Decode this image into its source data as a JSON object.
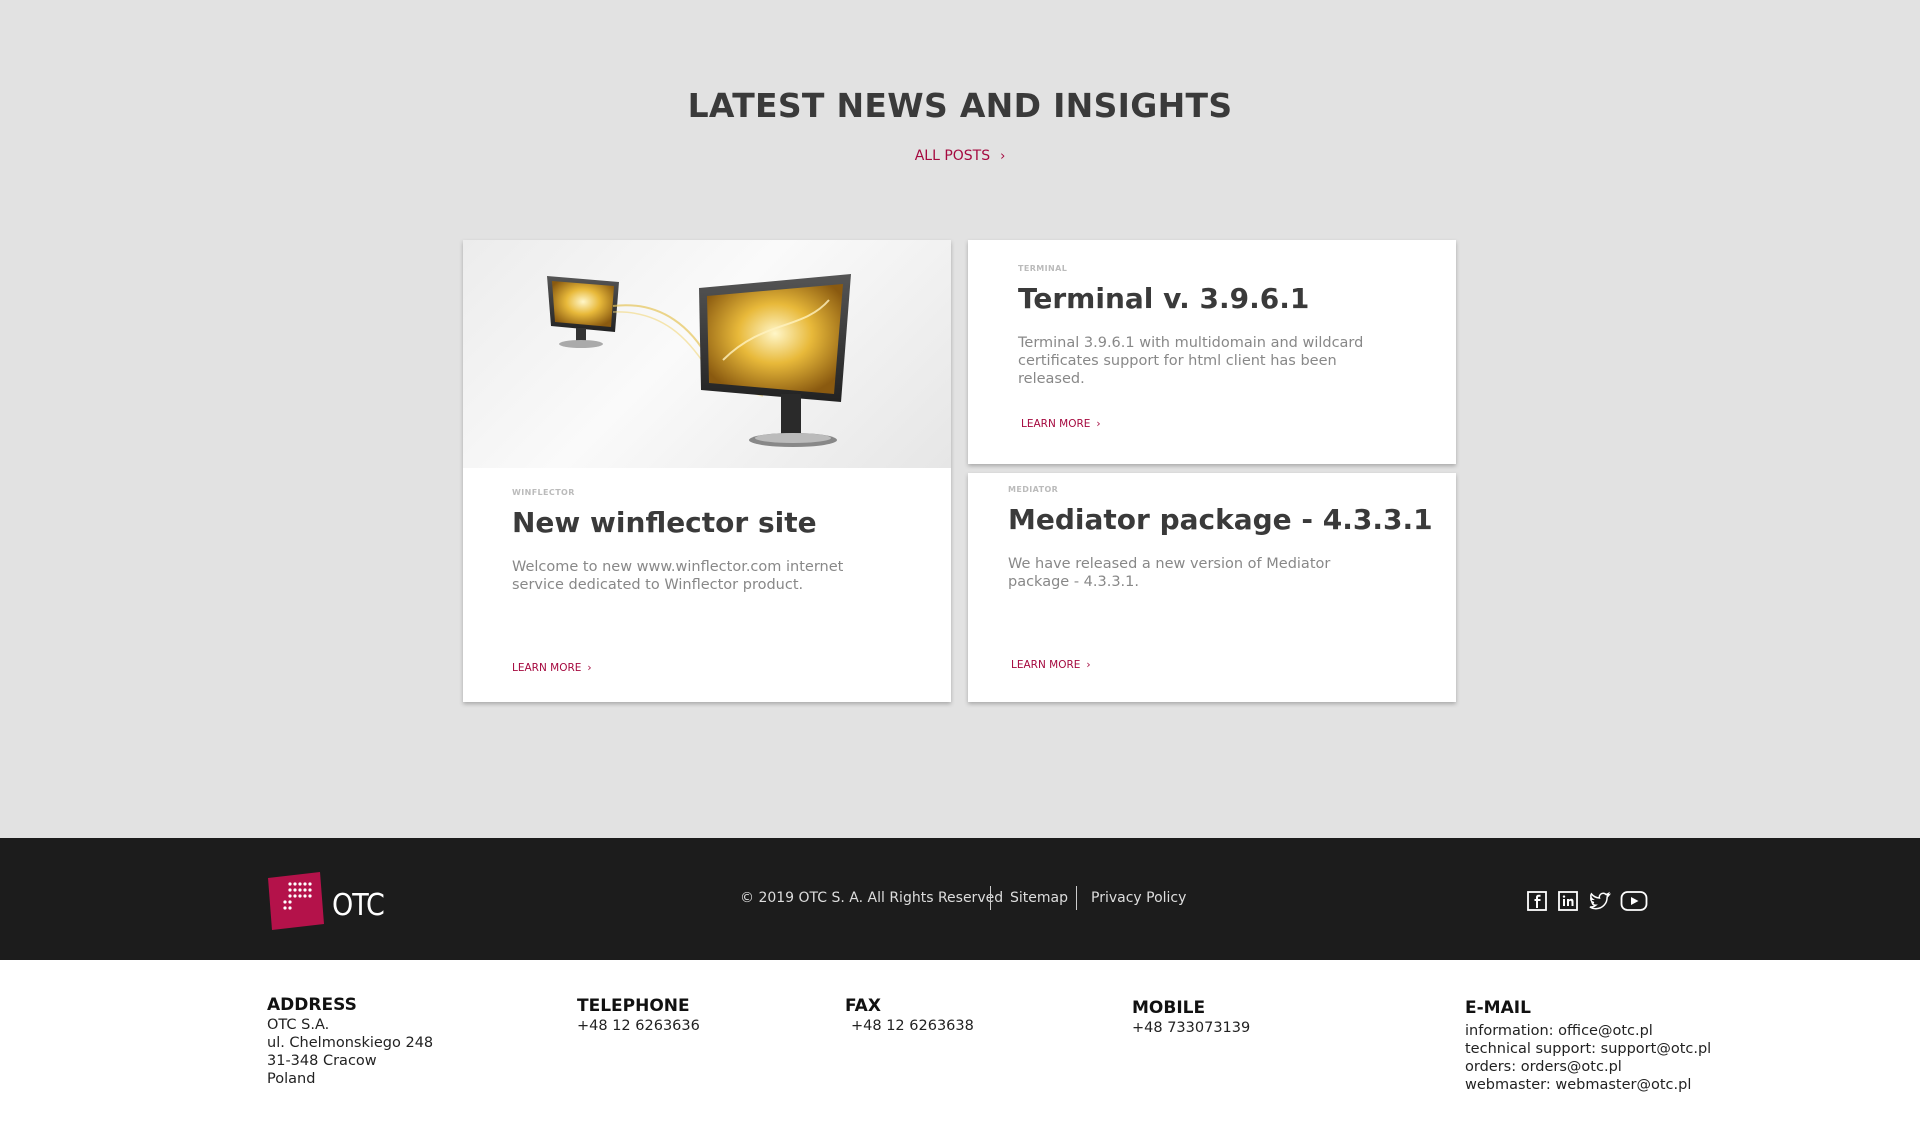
{
  "news": {
    "title": "LATEST NEWS AND INSIGHTS",
    "all_posts_label": "ALL POSTS",
    "chevron": "›",
    "cards": [
      {
        "tag": "WINFLECTOR",
        "title": "New winflector site",
        "text": "Welcome to new www.winflector.com internet service dedicated to Winflector product.",
        "learn_more": "LEARN MORE",
        "image": "monitors-illustration"
      },
      {
        "tag": "TERMINAL",
        "title": "Terminal v. 3.9.6.1",
        "text": "Terminal 3.9.6.1 with multidomain and wildcard certificates support for html client has been released.",
        "learn_more": "LEARN MORE"
      },
      {
        "tag": "MEDIATOR",
        "title": "Mediator package - 4.3.3.1",
        "text": "We have released a new version of Mediator package - 4.3.3.1.",
        "learn_more": "LEARN MORE"
      }
    ]
  },
  "footer": {
    "logo_text": "OTC",
    "copyright": "© 2019 OTC S. A. All Rights Reserved",
    "links": [
      "Sitemap",
      "Privacy Policy"
    ],
    "social_icons": [
      "facebook-icon",
      "linkedin-icon",
      "twitter-icon",
      "youtube-icon"
    ]
  },
  "contact": {
    "address": {
      "label": "ADDRESS",
      "lines": [
        "OTC S.A.",
        "ul. Chelmonskiego 248",
        "31-348 Cracow",
        "Poland"
      ]
    },
    "telephone": {
      "label": "TELEPHONE",
      "value": "+48 12 6263636"
    },
    "fax": {
      "label": "FAX",
      "value": "+48 12 6263638"
    },
    "mobile": {
      "label": "MOBILE",
      "value": "+48 733073139"
    },
    "email": {
      "label": "E-MAIL",
      "lines": [
        "information:  office@otc.pl",
        "technical support:  support@otc.pl",
        "orders:  orders@otc.pl",
        "webmaster: webmaster@otc.pl"
      ]
    }
  },
  "colors": {
    "accent": "#a5093f",
    "footer_bg": "#1c1c1c",
    "section_bg": "#e2e2e2"
  }
}
